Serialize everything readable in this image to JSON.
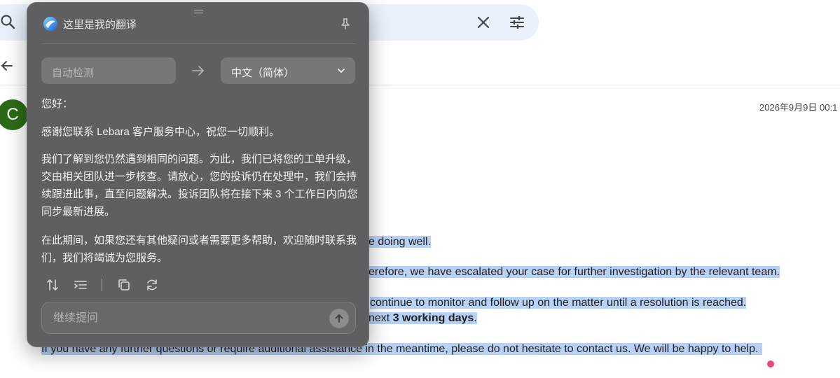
{
  "search": {
    "value": ""
  },
  "email": {
    "avatar_letter": "C",
    "date": "2026年9月9日 00:1",
    "lines": {
      "l1": "e doing well.",
      "l2": "erefore, we have escalated your case for further investigation by the relevant team.",
      "l3": "continue to monitor and follow up on the matter until a resolution is reached.",
      "l4_a": "next ",
      "l4_bold": "3 working days",
      "l4_b": ".",
      "l5": "If you have any further questions or require additional assistance in the meantime, please do not hesitate to contact us. We will be happy to help."
    }
  },
  "panel": {
    "title": "这里是我的翻译",
    "source_lang": "自动检测",
    "target_lang": "中文（简体）",
    "paragraphs": [
      "您好：",
      "感谢您联系 Lebara 客户服务中心，祝您一切顺利。",
      "我们了解到您仍然遇到相同的问题。为此，我们已将您的工单升级，交由相关团队进一步核查。请放心，您的投诉仍在处理中，我们会持续跟进此事，直至问题解决。投诉团队将在接下来 3 个工作日内向您同步最新进展。",
      "在此期间，如果您还有其他疑问或者需要更多帮助，欢迎随时联系我们，我们将竭诚为您服务。"
    ],
    "followup_placeholder": "继续提问"
  },
  "icons": {
    "search": "search-icon",
    "clear": "close-icon",
    "filter": "tune-icon",
    "back": "arrow-left-icon",
    "logo": "translate-logo-icon",
    "pin": "pin-icon",
    "swap": "swap-vertical-icon",
    "list": "list-indent-icon",
    "copy": "copy-icon",
    "refresh": "refresh-icon",
    "send": "arrow-up-icon"
  },
  "colors": {
    "selection": "#b9d1f5",
    "panel_bg": "#5f5f61",
    "avatar": "#2c6b16",
    "cursor_dot": "#e8457c"
  }
}
